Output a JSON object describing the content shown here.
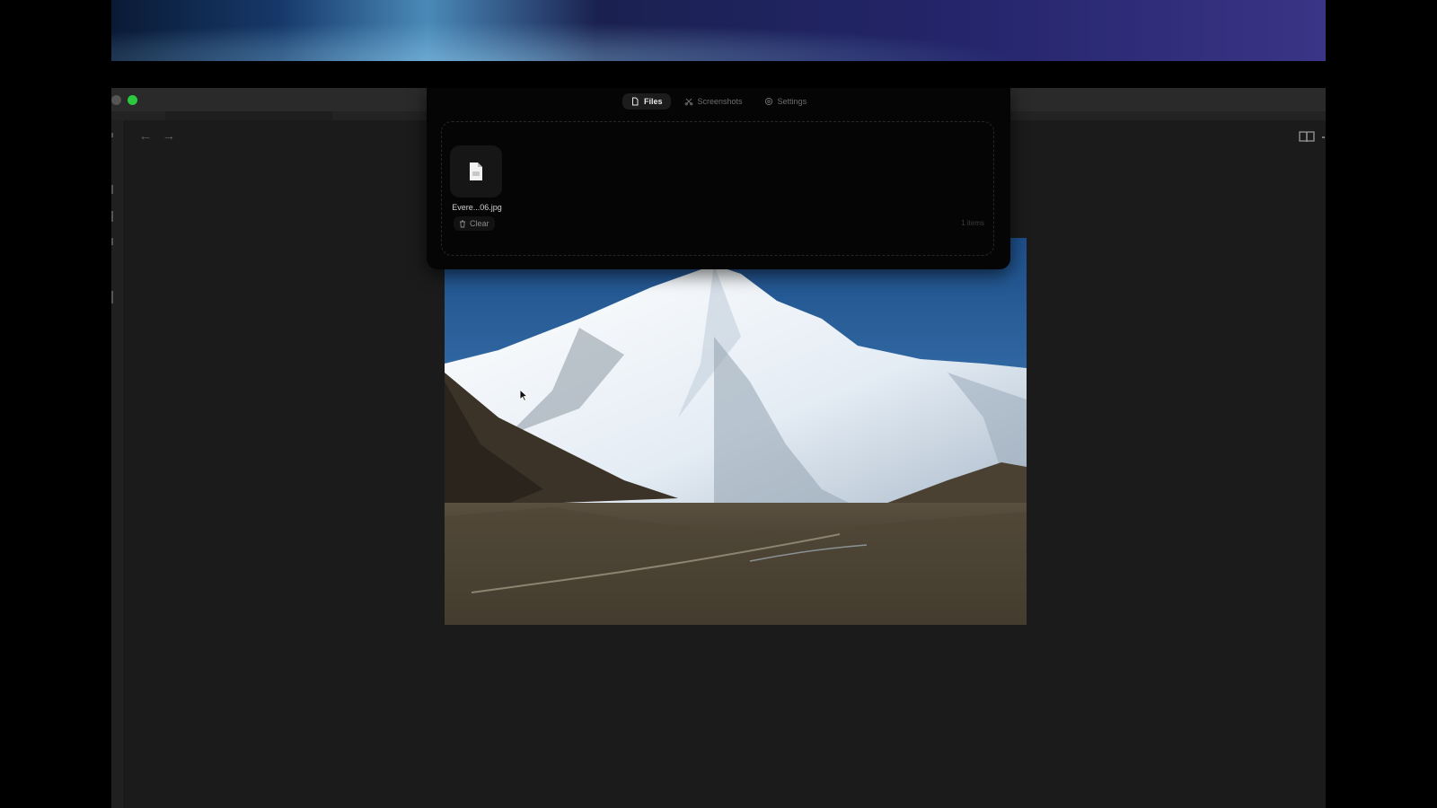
{
  "panel": {
    "tabs": [
      {
        "label": "Files",
        "icon": "files-icon",
        "active": true
      },
      {
        "label": "Screenshots",
        "icon": "screenshots-icon",
        "active": false
      },
      {
        "label": "Settings",
        "icon": "settings-icon",
        "active": false
      }
    ],
    "file": {
      "name": "Evere...06.jpg",
      "icon": "document-icon"
    },
    "clear_label": "Clear",
    "items_count": "1 items"
  },
  "window": {
    "traffic_lights": [
      "gray",
      "green"
    ],
    "nav_back_icon": "arrow-left-icon",
    "nav_forward_icon": "arrow-right-icon",
    "reader_icon": "book-open-icon"
  },
  "colors": {
    "accent_green": "#2bc840",
    "panel_bg": "#050505",
    "window_bg": "#1b1b1b"
  }
}
